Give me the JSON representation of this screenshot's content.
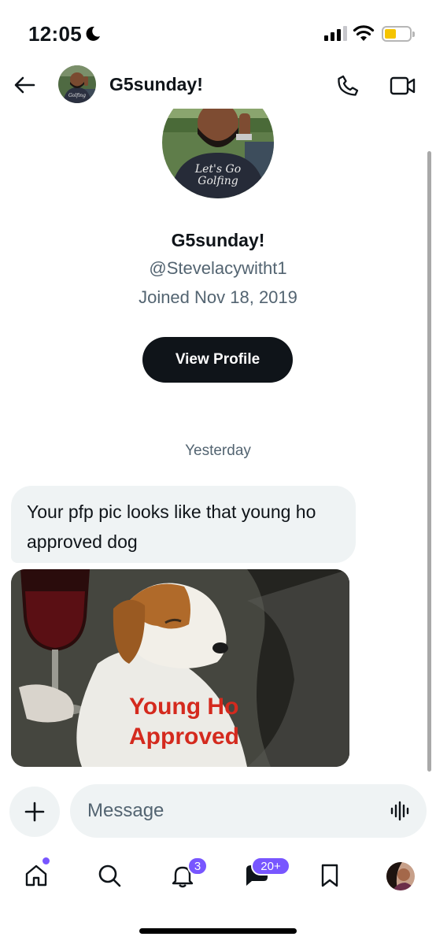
{
  "status_bar": {
    "time": "12:05"
  },
  "header": {
    "title": "G5sunday!"
  },
  "profile": {
    "name": "G5sunday!",
    "handle": "@Stevelacywitht1",
    "joined": "Joined Nov 18, 2019",
    "view_profile_label": "View Profile",
    "shirt_text": "Let's Go Golfing"
  },
  "conversation": {
    "date_separator": "Yesterday",
    "message_text": "Your pfp pic looks like that young ho approved dog",
    "image_caption": "Young Ho Approved"
  },
  "composer": {
    "placeholder": "Message"
  },
  "nav": {
    "notifications_badge": "3",
    "messages_badge": "20+"
  },
  "colors": {
    "accent": "#7856ff",
    "button_dark": "#0f1419",
    "bubble_bg": "#eff3f4",
    "secondary_text": "#536471",
    "battery": "#f5c400"
  },
  "icons": [
    "back-arrow-icon",
    "phone-icon",
    "video-icon",
    "plus-icon",
    "audio-wave-icon",
    "home-icon",
    "search-icon",
    "bell-icon",
    "messages-icon",
    "bookmark-icon"
  ]
}
